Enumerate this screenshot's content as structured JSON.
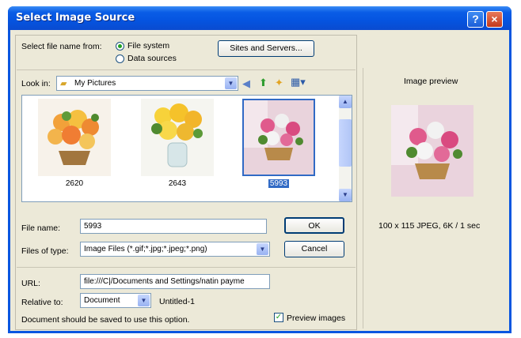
{
  "window": {
    "title": "Select Image Source",
    "help_glyph": "?",
    "close_glyph": "×"
  },
  "source": {
    "label": "Select file name from:",
    "options": [
      "File system",
      "Data sources"
    ],
    "selected": "File system",
    "sites_button": "Sites and Servers..."
  },
  "lookin": {
    "label": "Look in:",
    "value": "My Pictures"
  },
  "thumbnails": [
    {
      "name": "2620",
      "selected": false
    },
    {
      "name": "2643",
      "selected": false
    },
    {
      "name": "5993",
      "selected": true
    }
  ],
  "filename": {
    "label": "File name:",
    "value": "5993",
    "ok_button": "OK"
  },
  "filetype": {
    "label": "Files of type:",
    "value": "Image Files (*.gif;*.jpg;*.jpeg;*.png)",
    "cancel_button": "Cancel"
  },
  "url": {
    "label": "URL:",
    "value": "file:///C|/Documents and Settings/natin payme"
  },
  "relative": {
    "label": "Relative to:",
    "value": "Document",
    "suffix": "Untitled-1"
  },
  "note": "Document should be saved to use this option.",
  "preview_images": {
    "label": "Preview images",
    "checked": true
  },
  "preview": {
    "title": "Image preview",
    "info": "100 x 115 JPEG, 6K / 1 sec"
  },
  "colors": {
    "titlebar": "#0a56e0",
    "selection": "#316ac5",
    "face": "#ece9d8"
  },
  "icons": [
    "help-icon",
    "close-icon",
    "folder-icon",
    "back-icon",
    "up-folder-icon",
    "new-folder-icon",
    "view-menu-icon"
  ]
}
